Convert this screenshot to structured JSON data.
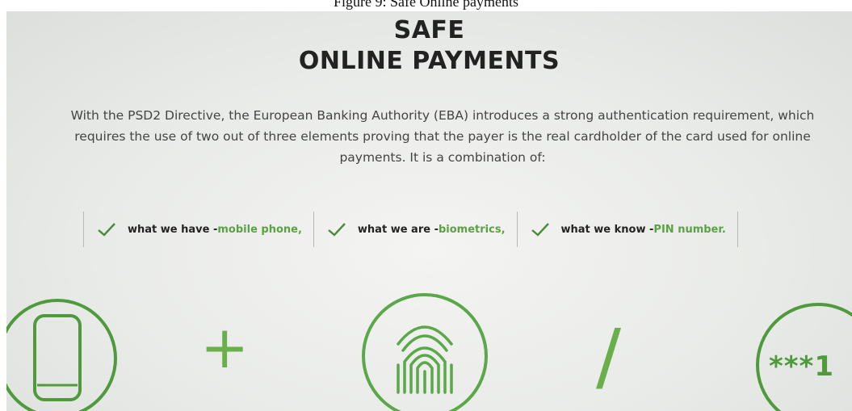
{
  "caption": "Figure 9: Safe Online payments",
  "title_line1": "SAFE",
  "title_line2": "ONLINE PAYMENTS",
  "intro_line1": "With the PSD2 Directive, the European Banking Authority (EBA) introduces a strong authentication requirement, which",
  "intro_line2": "requires the use of two out of three elements proving that the payer is the real cardholder of the card used for online",
  "intro_line3": "payments. It is a combination of:",
  "features": [
    {
      "label": "what we have - ",
      "value": "mobile phone,"
    },
    {
      "label": "what we are - ",
      "value": "biometrics,"
    },
    {
      "label": "what we know - ",
      "value": "PIN number."
    }
  ],
  "operator_plus": "+",
  "operator_slash": "/",
  "pin_text": "***1",
  "colors": {
    "accent": "#5aa243",
    "text": "#222222"
  },
  "icons": [
    "check-icon",
    "mobile-phone-icon",
    "fingerprint-icon",
    "pin-icon"
  ]
}
